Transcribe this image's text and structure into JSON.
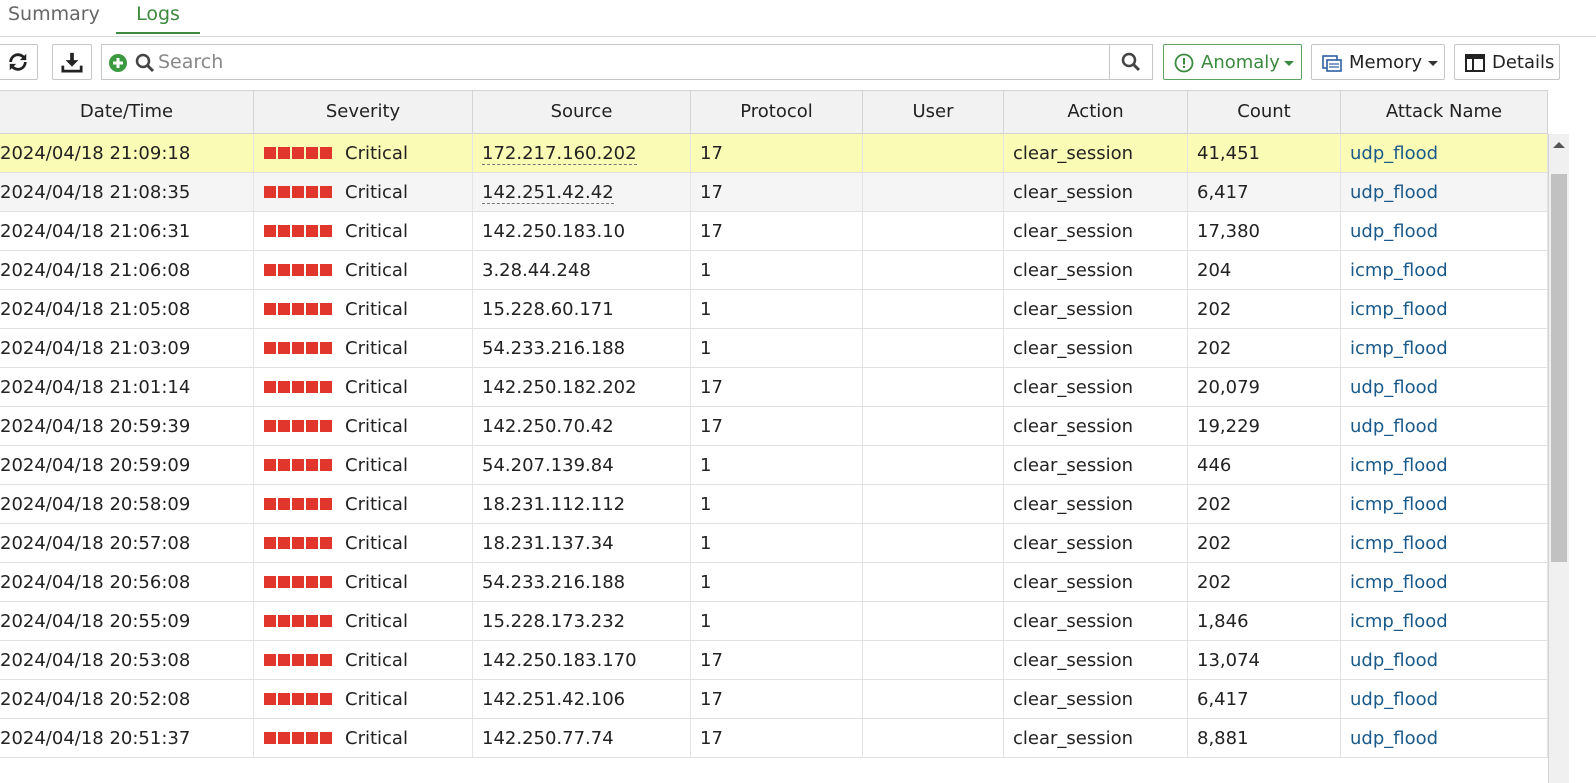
{
  "tabs": [
    {
      "label": "Summary",
      "active": false
    },
    {
      "label": "Logs",
      "active": true
    }
  ],
  "toolbar": {
    "search_placeholder": "Search",
    "anomaly_label": "Anomaly",
    "memory_label": "Memory",
    "details_label": "Details"
  },
  "colors": {
    "accent": "#3b8a3e",
    "critical": "#e0362c",
    "link": "#1a5a8a",
    "selected_row": "#fafbb4"
  },
  "columns": [
    "Date/Time",
    "Severity",
    "Source",
    "Protocol",
    "User",
    "Action",
    "Count",
    "Attack Name"
  ],
  "rows": [
    {
      "datetime": "2024/04/18 21:09:18",
      "severity": "Critical",
      "source": "172.217.160.202",
      "protocol": "17",
      "user": "",
      "action": "clear_session",
      "count": "41,451",
      "attack": "udp_flood"
    },
    {
      "datetime": "2024/04/18 21:08:35",
      "severity": "Critical",
      "source": "142.251.42.42",
      "protocol": "17",
      "user": "",
      "action": "clear_session",
      "count": "6,417",
      "attack": "udp_flood"
    },
    {
      "datetime": "2024/04/18 21:06:31",
      "severity": "Critical",
      "source": "142.250.183.10",
      "protocol": "17",
      "user": "",
      "action": "clear_session",
      "count": "17,380",
      "attack": "udp_flood"
    },
    {
      "datetime": "2024/04/18 21:06:08",
      "severity": "Critical",
      "source": "3.28.44.248",
      "protocol": "1",
      "user": "",
      "action": "clear_session",
      "count": "204",
      "attack": "icmp_flood"
    },
    {
      "datetime": "2024/04/18 21:05:08",
      "severity": "Critical",
      "source": "15.228.60.171",
      "protocol": "1",
      "user": "",
      "action": "clear_session",
      "count": "202",
      "attack": "icmp_flood"
    },
    {
      "datetime": "2024/04/18 21:03:09",
      "severity": "Critical",
      "source": "54.233.216.188",
      "protocol": "1",
      "user": "",
      "action": "clear_session",
      "count": "202",
      "attack": "icmp_flood"
    },
    {
      "datetime": "2024/04/18 21:01:14",
      "severity": "Critical",
      "source": "142.250.182.202",
      "protocol": "17",
      "user": "",
      "action": "clear_session",
      "count": "20,079",
      "attack": "udp_flood"
    },
    {
      "datetime": "2024/04/18 20:59:39",
      "severity": "Critical",
      "source": "142.250.70.42",
      "protocol": "17",
      "user": "",
      "action": "clear_session",
      "count": "19,229",
      "attack": "udp_flood"
    },
    {
      "datetime": "2024/04/18 20:59:09",
      "severity": "Critical",
      "source": "54.207.139.84",
      "protocol": "1",
      "user": "",
      "action": "clear_session",
      "count": "446",
      "attack": "icmp_flood"
    },
    {
      "datetime": "2024/04/18 20:58:09",
      "severity": "Critical",
      "source": "18.231.112.112",
      "protocol": "1",
      "user": "",
      "action": "clear_session",
      "count": "202",
      "attack": "icmp_flood"
    },
    {
      "datetime": "2024/04/18 20:57:08",
      "severity": "Critical",
      "source": "18.231.137.34",
      "protocol": "1",
      "user": "",
      "action": "clear_session",
      "count": "202",
      "attack": "icmp_flood"
    },
    {
      "datetime": "2024/04/18 20:56:08",
      "severity": "Critical",
      "source": "54.233.216.188",
      "protocol": "1",
      "user": "",
      "action": "clear_session",
      "count": "202",
      "attack": "icmp_flood"
    },
    {
      "datetime": "2024/04/18 20:55:09",
      "severity": "Critical",
      "source": "15.228.173.232",
      "protocol": "1",
      "user": "",
      "action": "clear_session",
      "count": "1,846",
      "attack": "icmp_flood"
    },
    {
      "datetime": "2024/04/18 20:53:08",
      "severity": "Critical",
      "source": "142.250.183.170",
      "protocol": "17",
      "user": "",
      "action": "clear_session",
      "count": "13,074",
      "attack": "udp_flood"
    },
    {
      "datetime": "2024/04/18 20:52:08",
      "severity": "Critical",
      "source": "142.251.42.106",
      "protocol": "17",
      "user": "",
      "action": "clear_session",
      "count": "6,417",
      "attack": "udp_flood"
    },
    {
      "datetime": "2024/04/18 20:51:37",
      "severity": "Critical",
      "source": "142.250.77.74",
      "protocol": "17",
      "user": "",
      "action": "clear_session",
      "count": "8,881",
      "attack": "udp_flood"
    }
  ]
}
